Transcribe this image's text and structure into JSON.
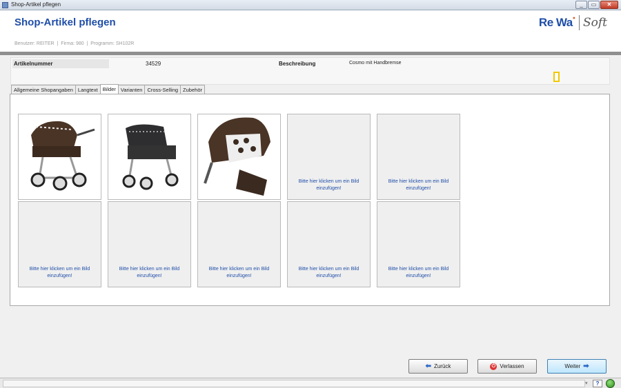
{
  "window": {
    "title": "Shop-Artikel pflegen",
    "buttons": [
      "_",
      "▭",
      "✕"
    ]
  },
  "header": {
    "title": "Shop-Artikel pflegen",
    "meta": {
      "user_label": "Benutzer:",
      "user": "REITER",
      "firma_label": "Firma:",
      "firma": "980",
      "programm_label": "Programm:",
      "programm": "SH102R"
    },
    "logo": {
      "part1": "Re Wa",
      "part2": "Soft"
    }
  },
  "info": {
    "artikelnummer_label": "Artikelnummer",
    "artikelnummer": "34529",
    "beschreibung_label": "Beschreibung",
    "beschreibung": "Cosmo mit Handbremse"
  },
  "tabs": [
    {
      "label": "Allgemeine Shopangaben",
      "active": false
    },
    {
      "label": "Langtext",
      "active": false
    },
    {
      "label": "Bilder",
      "active": true
    },
    {
      "label": "Varianten",
      "active": false
    },
    {
      "label": "Cross-Selling",
      "active": false
    },
    {
      "label": "Zubehör",
      "active": false
    }
  ],
  "images": {
    "placeholder_text": "Bitte hier klicken um ein Bild einzufügen!",
    "filled_count": 3
  },
  "footer": {
    "back_label": "Zurück",
    "exit_label": "Verlassen",
    "next_label": "Weiter"
  },
  "statusbar": {
    "help": "?",
    "dropdown": "▾"
  },
  "colors": {
    "title_blue": "#1f4ea8",
    "divider_gray": "#8f8f8f",
    "marker_yellow": "#f0c800"
  }
}
